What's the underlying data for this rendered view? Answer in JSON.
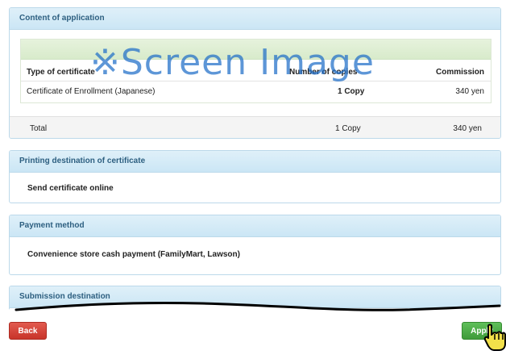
{
  "sections": {
    "content": {
      "title": "Content of application",
      "columns": {
        "type": "Type of certificate",
        "copies": "Number of copies",
        "commission": "Commission"
      },
      "rows": [
        {
          "type": "Certificate of Enrollment (Japanese)",
          "copies": "1 Copy",
          "commission": "340 yen"
        }
      ],
      "total": {
        "label": "Total",
        "copies": "1 Copy",
        "commission": "340 yen"
      }
    },
    "printing": {
      "title": "Printing destination of certificate",
      "value": "Send certificate online"
    },
    "payment": {
      "title": "Payment method",
      "value": "Convenience store cash payment (FamilyMart, Lawson)"
    },
    "submission": {
      "title": "Submission destination"
    }
  },
  "watermark": "※Screen Image",
  "buttons": {
    "back": "Back",
    "apply": "Apply"
  },
  "colors": {
    "header_text": "#2d5f80",
    "back_button": "#c8342a",
    "apply_button": "#3f9b39",
    "watermark": "#1e6ec8"
  },
  "icons": {
    "cursor": "pointing-hand-cursor-icon"
  }
}
